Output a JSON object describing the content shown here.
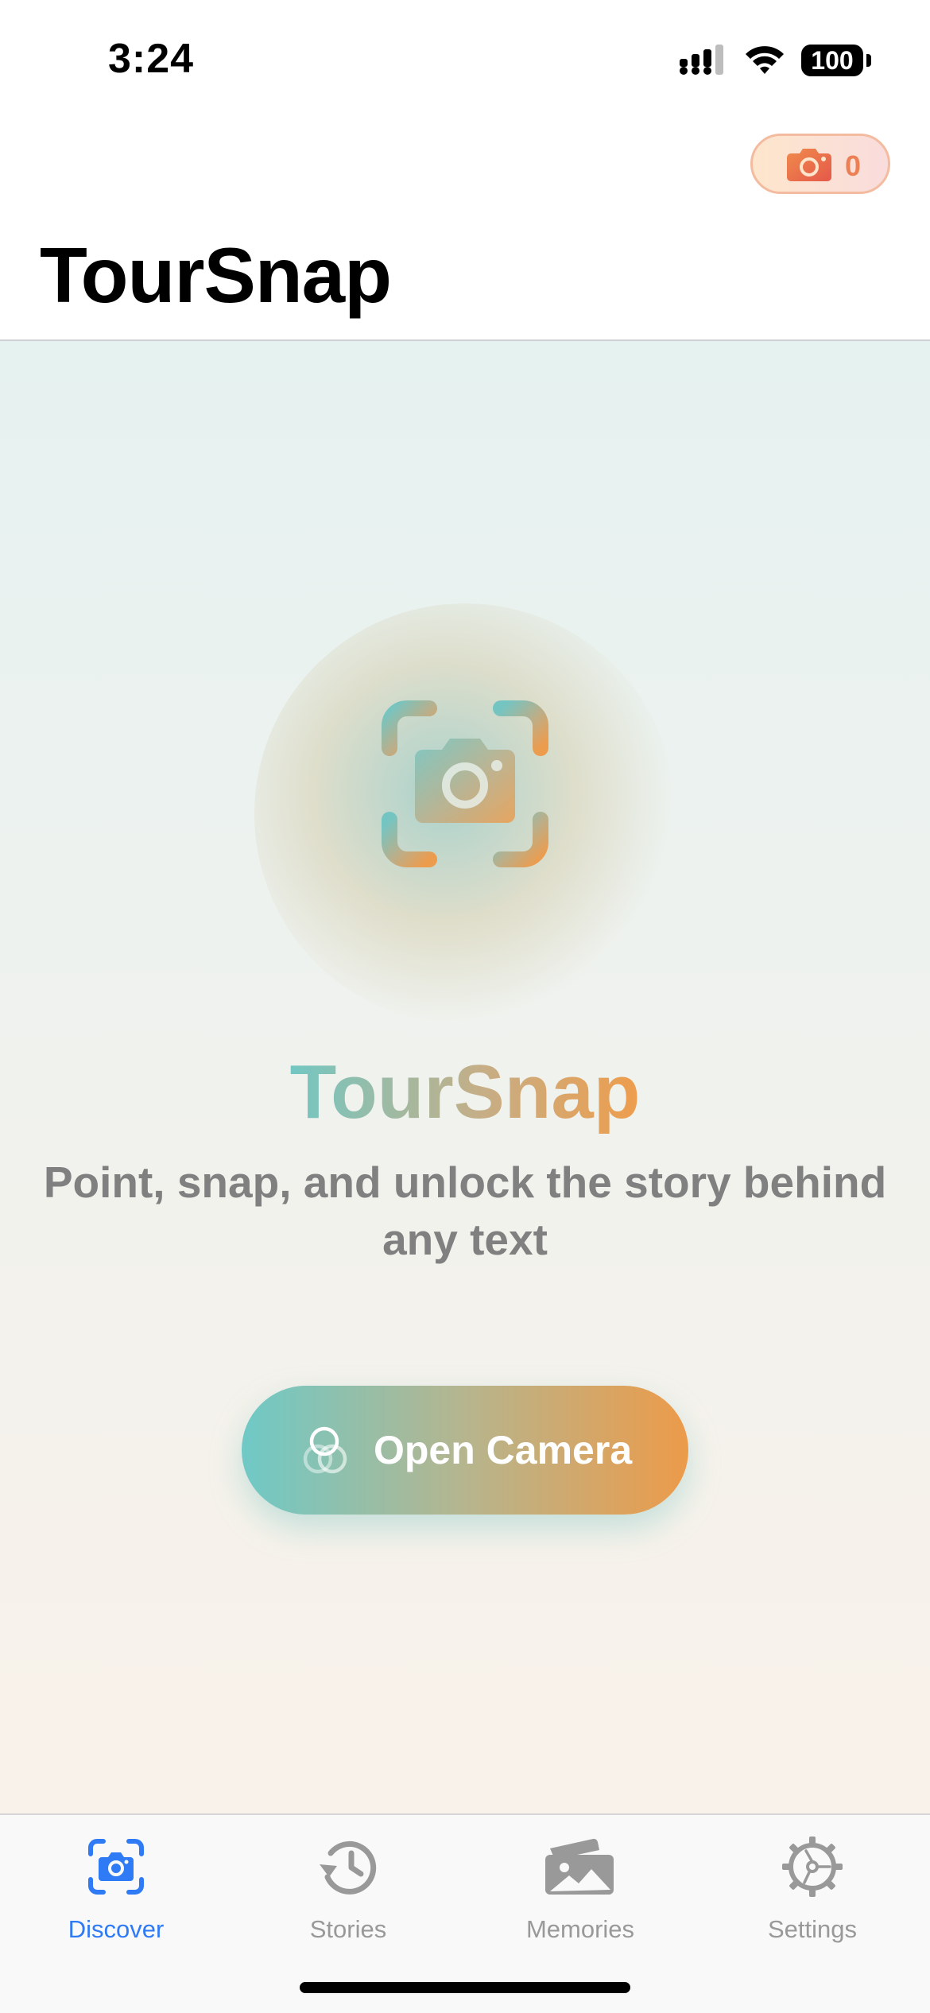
{
  "status_bar": {
    "time": "3:24",
    "battery": "100"
  },
  "header": {
    "title": "TourSnap",
    "scan_counter": {
      "icon": "camera-icon",
      "value": "0",
      "color": "#ec8054"
    }
  },
  "hero": {
    "icon": "camera-viewfinder-icon",
    "title": "TourSnap",
    "subtitle": "Point, snap, and unlock the story behind any text",
    "button": {
      "label": "Open Camera",
      "icon": "circles-icon"
    },
    "gradient_colors": [
      "#72c7c3",
      "#c6ae86",
      "#ee9d4c"
    ]
  },
  "tab_bar": {
    "active_color": "#2f7bf5",
    "inactive_color": "#999999",
    "items": [
      {
        "label": "Discover",
        "icon": "camera-viewfinder-icon",
        "active": true
      },
      {
        "label": "Stories",
        "icon": "history-clock-icon",
        "active": false
      },
      {
        "label": "Memories",
        "icon": "photo-stack-icon",
        "active": false
      },
      {
        "label": "Settings",
        "icon": "gear-icon",
        "active": false
      }
    ]
  }
}
